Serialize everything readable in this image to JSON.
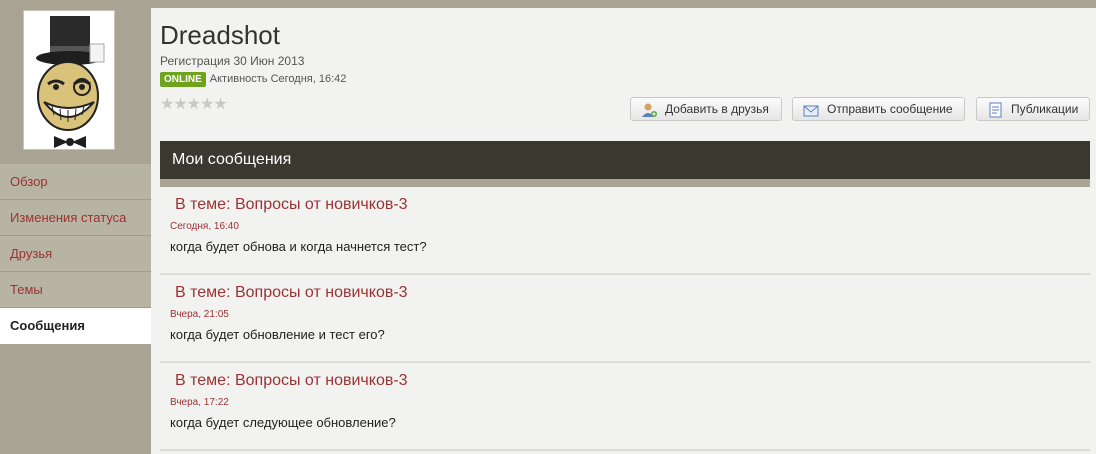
{
  "profile": {
    "username": "Dreadshot",
    "registration": "Регистрация 30 Июн 2013",
    "online_badge": "ONLINE",
    "activity": "Активность Сегодня, 16:42",
    "rating_stars": 0,
    "rating_max": 5
  },
  "sidebar": {
    "items": [
      {
        "label": "Обзор"
      },
      {
        "label": "Изменения статуса"
      },
      {
        "label": "Друзья"
      },
      {
        "label": "Темы"
      },
      {
        "label": "Сообщения"
      }
    ],
    "active_index": 4
  },
  "buttons": {
    "add_friend": "Добавить в друзья",
    "send_message": "Отправить сообщение",
    "publications": "Публикации"
  },
  "section": {
    "title": "Мои сообщения"
  },
  "posts": [
    {
      "title": "В теме: Вопросы от новичков-3",
      "date": "Сегодня, 16:40",
      "text": "когда будет обнова и когда начнется тест?"
    },
    {
      "title": "В теме: Вопросы от новичков-3",
      "date": "Вчера, 21:05",
      "text": "когда будет обновление и тест его?"
    },
    {
      "title": "В теме: Вопросы от новичков-3",
      "date": "Вчера, 17:22",
      "text": "когда будет следующее обновление?"
    }
  ],
  "colors": {
    "accent_red": "#9a3333",
    "sidebar_bg": "#a8a392",
    "header_dark": "#3a3930",
    "online_green": "#6fa21f"
  }
}
